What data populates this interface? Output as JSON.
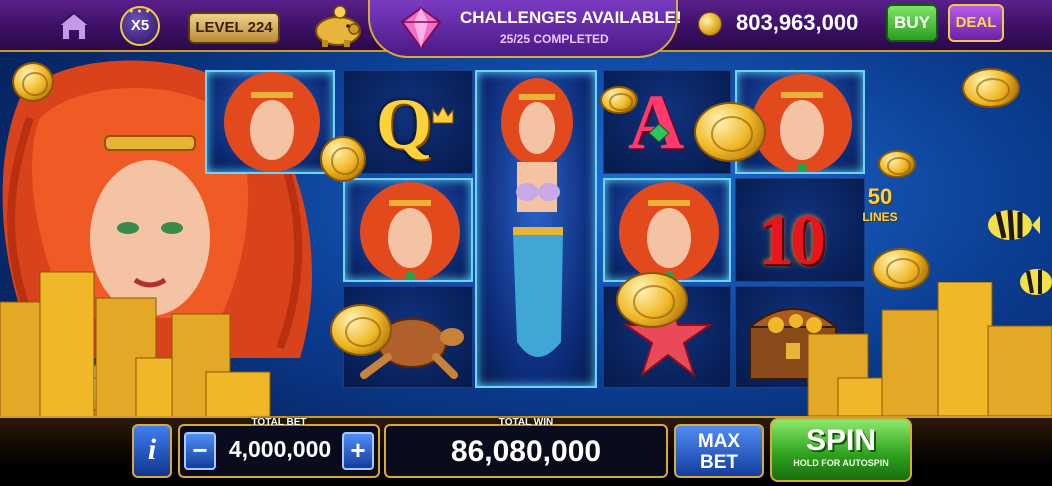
{
  "top_bar": {
    "multiplier": "X5",
    "level": "LEVEL 224",
    "challenges_title": "CHALLENGES AVAILABLE!",
    "challenges_progress": "25/25 COMPLETED",
    "balance": "803,963,000",
    "buy_label": "BUY",
    "deal_label": "DEAL"
  },
  "reels": {
    "symbols": {
      "q": "Q",
      "a": "A",
      "ten": "10"
    },
    "lines_count": "50",
    "lines_label": "LINES"
  },
  "bottom_bar": {
    "info_label": "i",
    "total_bet_label": "TOTAL BET",
    "minus_label": "−",
    "total_bet": "4,000,000",
    "plus_label": "+",
    "total_win_label": "TOTAL WIN",
    "total_win": "86,080,000",
    "max_bet_label_1": "MAX",
    "max_bet_label_2": "BET",
    "spin_label": "SPIN",
    "spin_sub_label": "HOLD FOR AUTOSPIN"
  },
  "colors": {
    "accent_gold": "#d7aa3a",
    "top_bar_purple": "#4b1a86",
    "spin_green": "#2c9e1c",
    "reel_blue": "#0b2a75"
  }
}
